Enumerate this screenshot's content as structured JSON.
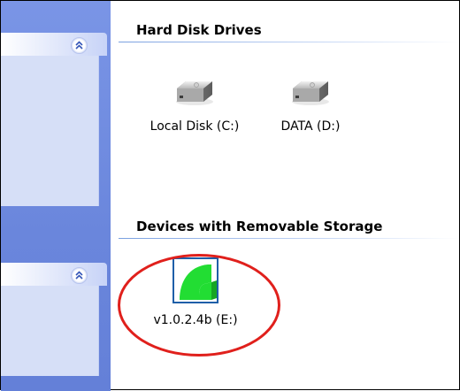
{
  "sections": {
    "hard_disk_drives": {
      "title": "Hard Disk Drives",
      "items": [
        {
          "label": "Local Disk (C:)",
          "icon": "hard-disk-icon"
        },
        {
          "label": "DATA (D:)",
          "icon": "hard-disk-icon"
        }
      ]
    },
    "removable_storage": {
      "title": "Devices with Removable Storage",
      "items": [
        {
          "label": "v1.0.2.4b (E:)",
          "icon": "removable-drive-icon",
          "icon_color": "#22dd33"
        }
      ]
    }
  },
  "taskpane": {
    "collapse_glyph": "»",
    "accent": "#6a86dc",
    "panel_bg": "#d6dff7"
  },
  "highlight": {
    "color": "#e0201c"
  }
}
